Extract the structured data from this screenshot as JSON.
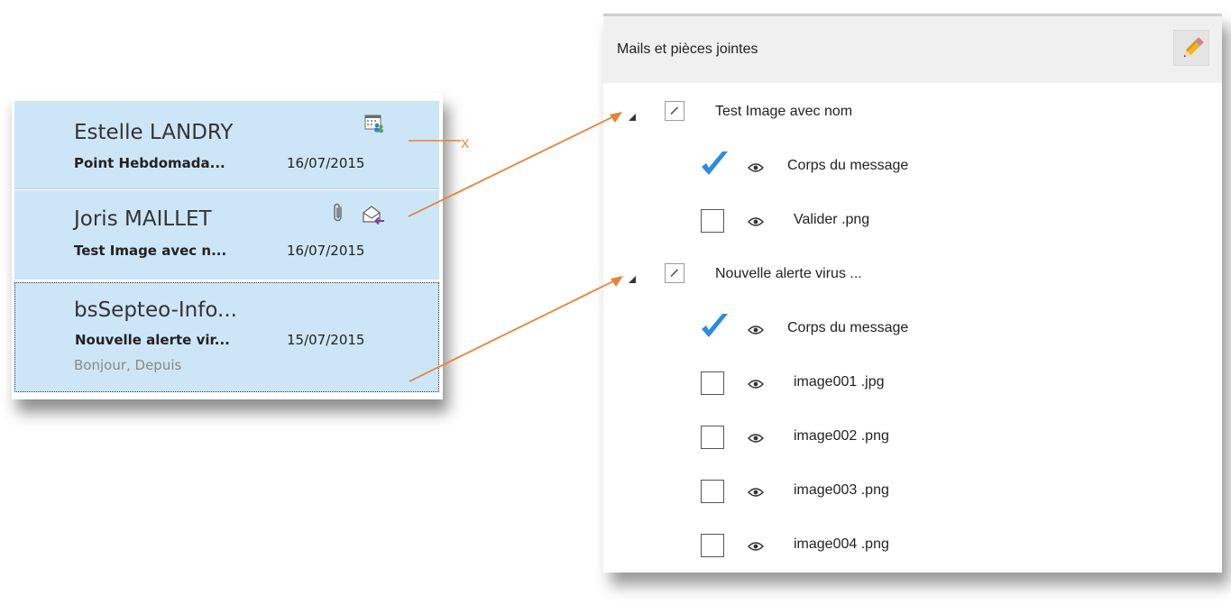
{
  "mail_list": {
    "items": [
      {
        "sender": "Estelle LANDRY",
        "subject": "Point Hebdomada...",
        "date": "16/07/2015",
        "icons": [
          "calendar-people-icon"
        ]
      },
      {
        "sender": "Joris MAILLET",
        "subject": "Test Image avec n...",
        "date": "16/07/2015",
        "icons": [
          "paperclip-icon",
          "envelope-arrow-icon"
        ]
      },
      {
        "sender": "bsSepteo-Info...",
        "subject": "Nouvelle alerte vir...",
        "date": "15/07/2015",
        "preview": "Bonjour,  Depuis"
      }
    ]
  },
  "annotation": {
    "x_label": "X",
    "color": "#e8813a"
  },
  "attachments_panel": {
    "title": "Mails et pièces jointes",
    "edit_icon": "pencil-icon",
    "groups": [
      {
        "label": "Test Image avec nom",
        "children": [
          {
            "label": "Corps du message",
            "checked": true
          },
          {
            "label": "Valider  .png",
            "checked": false
          }
        ]
      },
      {
        "label": "Nouvelle alerte virus ...",
        "children": [
          {
            "label": "Corps du message",
            "checked": true
          },
          {
            "label": "image001  .jpg",
            "checked": false
          },
          {
            "label": "image002  .png",
            "checked": false
          },
          {
            "label": "image003  .png",
            "checked": false
          },
          {
            "label": "image004  .png",
            "checked": false
          }
        ]
      }
    ]
  },
  "colors": {
    "selected_bg": "#cde6f7",
    "check_blue": "#2b8be0",
    "arrow": "#e8813a"
  }
}
